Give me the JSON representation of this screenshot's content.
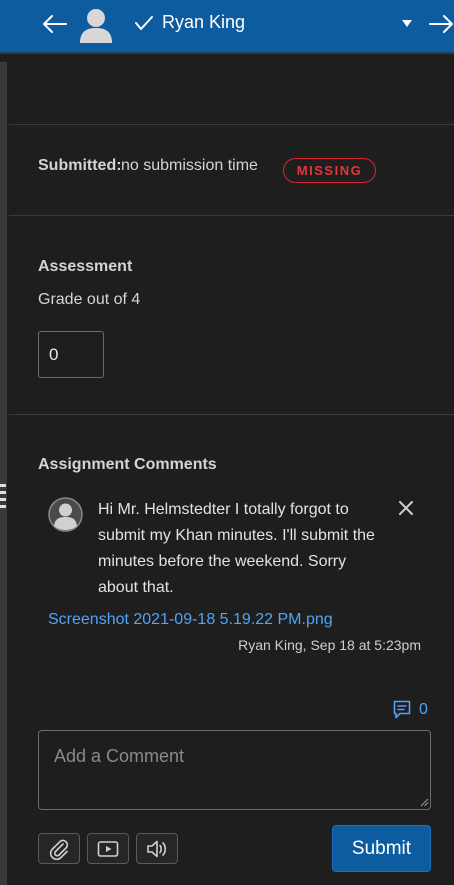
{
  "header": {
    "student_name": "Ryan King",
    "icons": [
      "arrow-left-icon",
      "avatar-icon",
      "checkmark-icon",
      "caret-down-icon",
      "arrow-right-icon"
    ]
  },
  "submission": {
    "label": "Submitted:",
    "value": "no submission time",
    "status_badge": "MISSING"
  },
  "assessment": {
    "heading": "Assessment",
    "grade_label": "Grade out of 4",
    "grade_value": "0"
  },
  "comments": {
    "heading": "Assignment Comments",
    "items": [
      {
        "text": "Hi Mr. Helmstedter I totally forgot to submit my Khan minutes. I'll submit the minutes before the weekend. Sorry about that.",
        "attachment": "Screenshot 2021-09-18 5.19.22 PM.png",
        "meta": "Ryan King, Sep 18 at 5:23pm"
      }
    ],
    "count": "0",
    "input_placeholder": "Add a Comment",
    "submit_label": "Submit"
  },
  "colors": {
    "header_bg": "#0e5ca0",
    "page_bg": "#1e1e1f",
    "missing_red": "#d9262d",
    "link_blue": "#4fa4f5"
  }
}
